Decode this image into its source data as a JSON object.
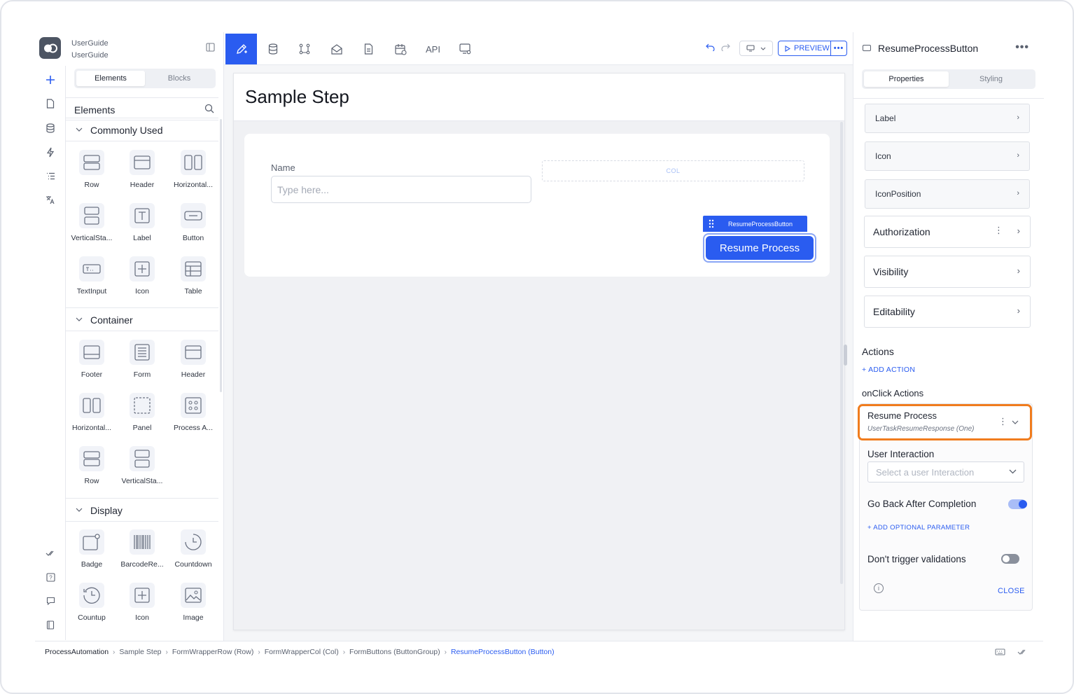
{
  "project": {
    "line1": "UserGuide",
    "line2": "UserGuide"
  },
  "palette": {
    "tabs": {
      "elements": "Elements",
      "blocks": "Blocks"
    },
    "header": "Elements",
    "sections": {
      "commonly_used": {
        "title": "Commonly Used",
        "items": [
          "Row",
          "Header",
          "Horizontal...",
          "VerticalSta...",
          "Label",
          "Button",
          "TextInput",
          "Icon",
          "Table"
        ]
      },
      "container": {
        "title": "Container",
        "items": [
          "Footer",
          "Form",
          "Header",
          "Horizontal...",
          "Panel",
          "Process A...",
          "Row",
          "VerticalSta..."
        ]
      },
      "display": {
        "title": "Display",
        "items": [
          "Badge",
          "BarcodeRe...",
          "Countdown",
          "Countup",
          "Icon",
          "Image"
        ]
      }
    }
  },
  "toolbar": {
    "api_label": "API",
    "preview_label": "PREVIEW",
    "more_label": "•••"
  },
  "canvas": {
    "page_title": "Sample Step",
    "field_label": "Name",
    "field_placeholder": "Type here...",
    "col_placeholder": "COL",
    "selected_tag": "ResumeProcessButton",
    "button_label": "Resume Process"
  },
  "right_panel": {
    "title": "ResumeProcessButton",
    "more": "•••",
    "tabs": {
      "properties": "Properties",
      "styling": "Styling"
    },
    "collapsed": [
      "Label",
      "Icon",
      "IconPosition"
    ],
    "groups": [
      "Authorization",
      "Visibility",
      "Editability"
    ],
    "actions_title": "Actions",
    "add_action": "+ ADD ACTION",
    "onclick_title": "onClick Actions",
    "action": {
      "title": "Resume Process",
      "subtitle": "UserTaskResumeResponse (One)"
    },
    "user_interaction_label": "User Interaction",
    "user_interaction_placeholder": "Select a user Interaction",
    "go_back_label": "Go Back After Completion",
    "go_back_on": true,
    "add_param": "+ ADD OPTIONAL PARAMETER",
    "dont_trigger_label": "Don't trigger validations",
    "dont_trigger_on": false,
    "close": "CLOSE"
  },
  "breadcrumb": [
    "ProcessAutomation",
    "Sample Step",
    "FormWrapperRow (Row)",
    "FormWrapperCol (Col)",
    "FormButtons (ButtonGroup)",
    "ResumeProcessButton (Button)"
  ],
  "colors": {
    "accent": "#2a5cf0",
    "highlight": "#f07c1e"
  }
}
